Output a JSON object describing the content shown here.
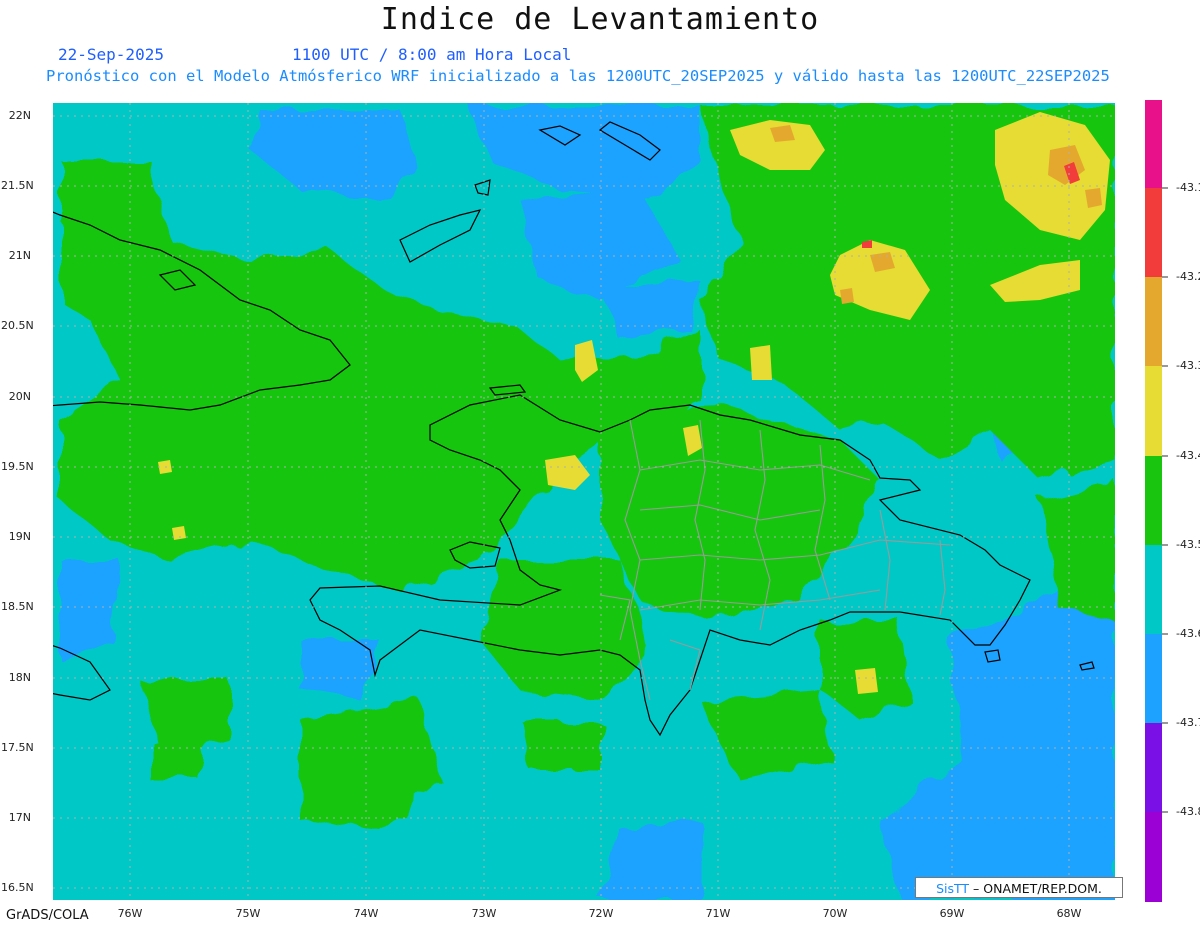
{
  "header": {
    "title": "Indice de Levantamiento",
    "date": "22-Sep-2025",
    "time": "1100 UTC / 8:00 am Hora Local",
    "description": "Pronóstico con el Modelo Atmósferico WRF inicializado a las 1200UTC_20SEP2025 y válido hasta las  1200UTC_22SEP2025"
  },
  "axes": {
    "latitude_labels": [
      "22N",
      "21.5N",
      "21N",
      "20.5N",
      "20N",
      "19.5N",
      "19N",
      "18.5N",
      "18N",
      "17.5N",
      "17N",
      "16.5N"
    ],
    "longitude_labels": [
      "76W",
      "75W",
      "74W",
      "73W",
      "72W",
      "71W",
      "70W",
      "69W",
      "68W"
    ]
  },
  "colorbar": {
    "labels": [
      "-43.1",
      "-43.2",
      "-43.3",
      "-43.4",
      "-43.5",
      "-43.6",
      "-43.7",
      "-43.8"
    ],
    "colors": [
      "#e8118a",
      "#f23b3b",
      "#e5a82e",
      "#e6dc33",
      "#19c50f",
      "#00c8c6",
      "#1ea2ff",
      "#7a10e6",
      "#9b00d4"
    ]
  },
  "legend_colors": {
    "ocean_base": "#00c8c6",
    "deep_blue": "#1ea2ff",
    "green": "#19c50f",
    "yellow": "#e6dc33",
    "orange": "#e5a82e",
    "red": "#f23b3b",
    "magenta": "#e8118a",
    "coast": "#000000",
    "province_border": "#9a9a9a"
  },
  "credit": {
    "brand": "SisTT",
    "text": " – ONAMET/REP.DOM."
  },
  "footer": {
    "software": "GrADS/COLA"
  }
}
